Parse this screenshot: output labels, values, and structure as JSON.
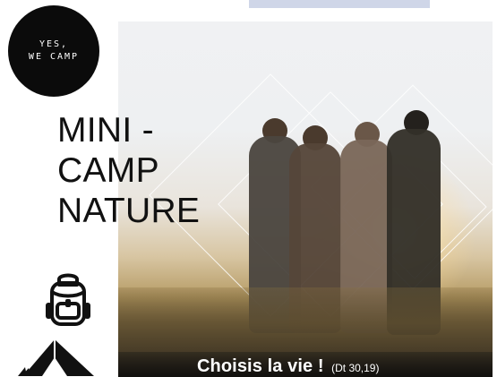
{
  "logo": {
    "line1": "YES,",
    "line2": "WE CAMP"
  },
  "title": {
    "line1": "MINI -",
    "line2": "CAMP",
    "line3": "NATURE"
  },
  "caption": {
    "main": "Choisis la vie !",
    "ref": "(Dt 30,19)"
  },
  "icons": {
    "backpack": "backpack-icon",
    "tent": "tent-icon"
  },
  "colors": {
    "title": "#111111",
    "logo_bg": "#0b0b0b",
    "logo_text": "#ffffff",
    "top_bar": "#cfd6e8"
  }
}
